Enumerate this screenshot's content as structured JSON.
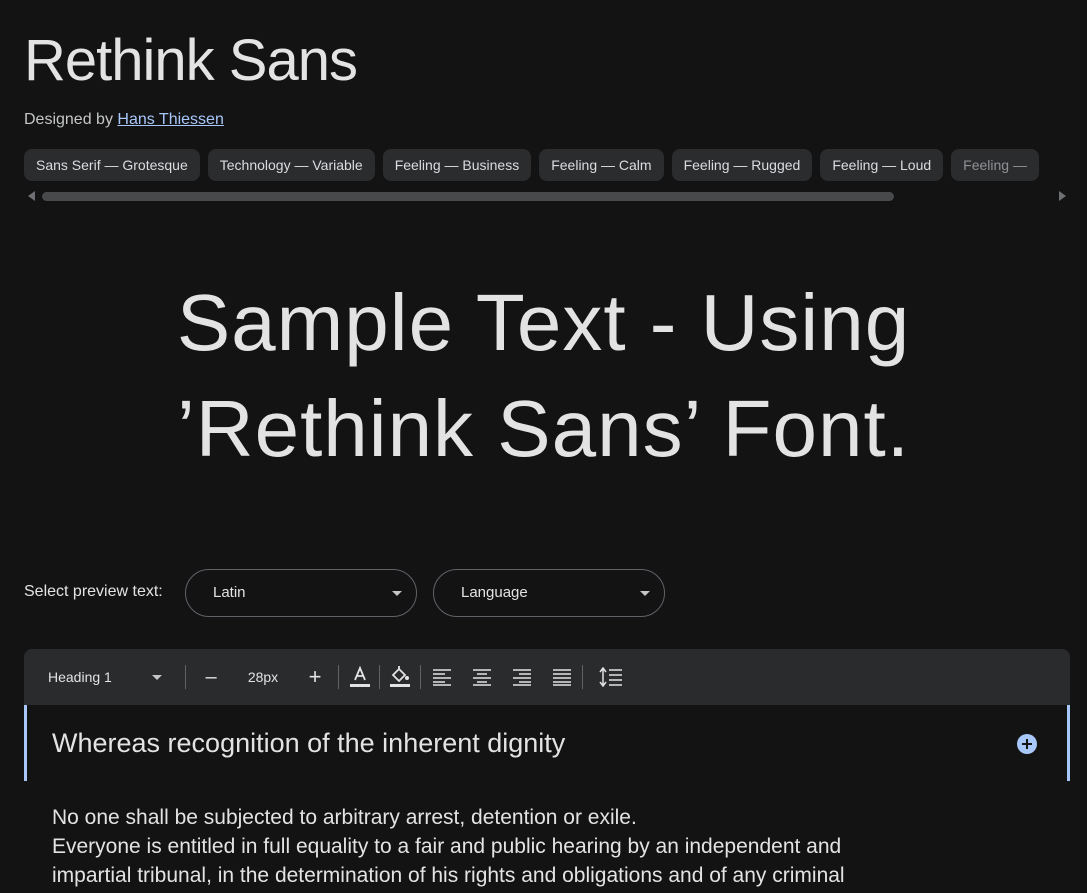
{
  "header": {
    "title": "Rethink Sans",
    "designed_by_label": "Designed by",
    "designer_name": "Hans Thiessen"
  },
  "tags": [
    "Sans Serif — Grotesque",
    "Technology — Variable",
    "Feeling — Business",
    "Feeling — Calm",
    "Feeling — Rugged",
    "Feeling — Loud",
    "Feeling —"
  ],
  "tag_scroll_fraction": 0.84,
  "sample": {
    "line1": "Sample Text - Using",
    "line2": "’Rethink Sans’ Font."
  },
  "preview": {
    "label": "Select preview text:",
    "script_select": "Latin",
    "language_select": "Language"
  },
  "toolbar": {
    "style_select": "Heading 1",
    "decrease": "–",
    "font_size": "28px",
    "increase": "+",
    "icons": [
      "text-color-icon",
      "highlight-color-icon",
      "align-left-icon",
      "align-center-icon",
      "align-right-icon",
      "align-justify-icon",
      "line-height-icon"
    ]
  },
  "editor": {
    "heading": "Whereas recognition of the inherent dignity",
    "paragraph_lines": [
      "No one shall be subjected to arbitrary arrest, detention or exile.",
      "Everyone is entitled in full equality to a fair and public hearing by an independent and",
      "impartial tribunal, in the determination of his rights and obligations and of any criminal"
    ]
  },
  "colors": {
    "background": "#131314",
    "accent": "#a8c7fa",
    "chip": "#2b2c2e",
    "toolbar": "#2a2b2d"
  }
}
